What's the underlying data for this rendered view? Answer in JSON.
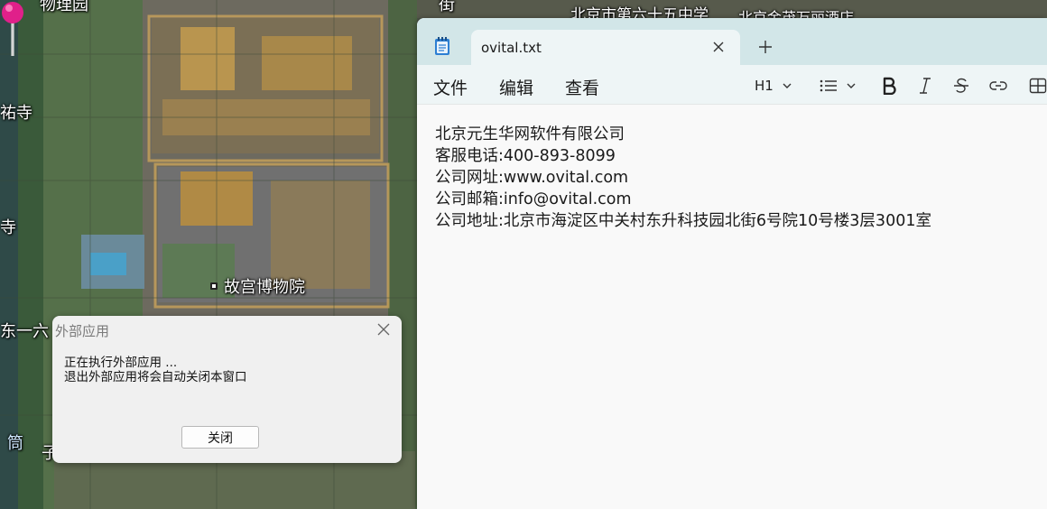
{
  "map": {
    "labels": {
      "top_left": "物理园",
      "top_center": "街",
      "top_right": "北京市第六十五中学",
      "top_far_right": "北京金茂万丽酒店",
      "left_1": "祐寺",
      "left_2": "寺",
      "left_3": "东一六",
      "bottom_left": "筒",
      "bottom_left_2": "子",
      "palace": "故宫博物院"
    }
  },
  "notepad": {
    "tab_title": "ovital.txt",
    "menu": {
      "file": "文件",
      "edit": "编辑",
      "view": "查看"
    },
    "toolbar": {
      "heading": "H1"
    },
    "content": [
      "北京元生华网软件有限公司",
      "客服电话:400-893-8099",
      "公司网址:www.ovital.com",
      "公司邮箱:info@ovital.com",
      "公司地址:北京市海淀区中关村东升科技园北街6号院10号楼3层3001室"
    ]
  },
  "dialog": {
    "title": "外部应用",
    "message_line1": "正在执行外部应用 ...",
    "message_line2": "退出外部应用将会自动关闭本窗口",
    "close_button": "关闭"
  },
  "colors": {
    "notepad_titlebar": "#d2e6e8",
    "notepad_menubar": "#eef5f6",
    "pin": "#e0208a"
  }
}
